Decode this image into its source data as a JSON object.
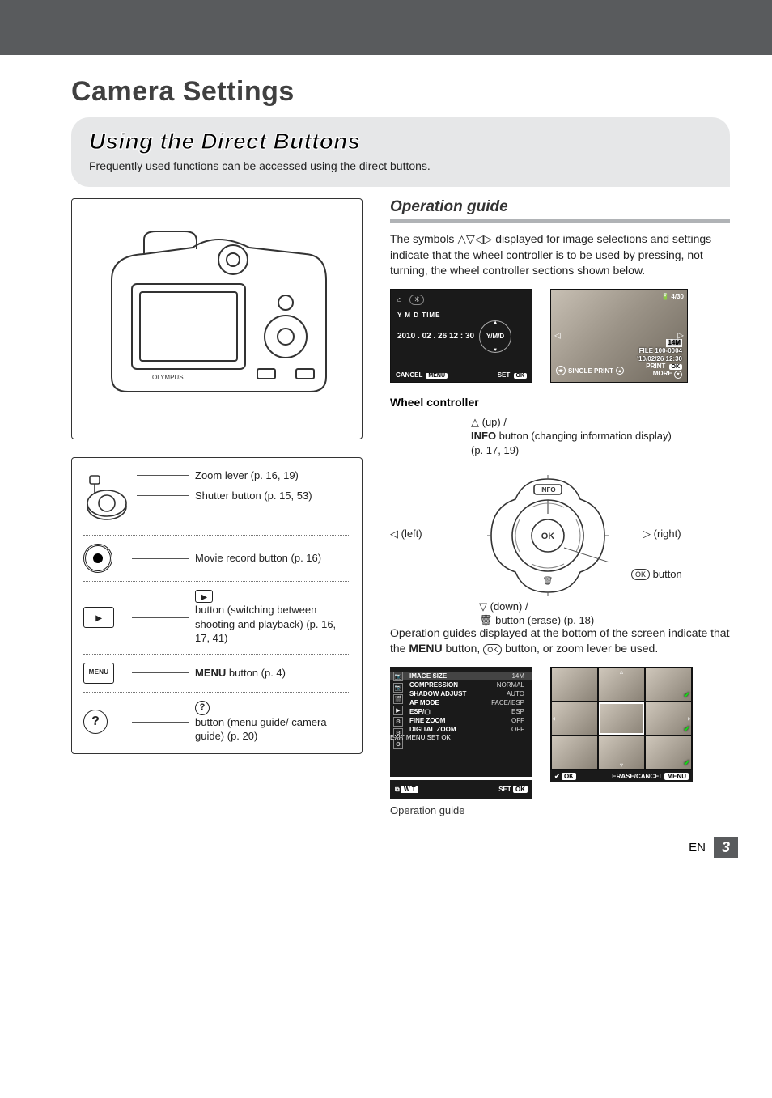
{
  "header": {
    "title": "Camera Settings",
    "section_title": "Using the Direct Buttons",
    "intro": "Frequently used functions can be accessed using the direct buttons."
  },
  "left_panel": {
    "buttons": {
      "zoom_lever": "Zoom lever (p. 16, 19)",
      "shutter": "Shutter button (p. 15, 53)",
      "movie_record": "Movie record button (p. 16)",
      "playback": " button (switching between shooting and playback) (p. 16, 17, 41)",
      "menu_prefix": "MENU",
      "menu_suffix": " button (p. 4)",
      "guide": " button (menu guide/ camera guide) (p. 20)"
    }
  },
  "right_panel": {
    "op_guide_heading": "Operation guide",
    "op_guide_para_a": "The symbols ",
    "op_guide_para_b": " displayed for image selections and settings indicate that the wheel controller is to be used by pressing, not turning, the wheel controller sections shown below.",
    "lcd_date": {
      "ymdt": "Y    M    D     TIME",
      "value": "2010 . 02 . 26   12 : 30",
      "yd": "Y/M/D",
      "cancel": "CANCEL",
      "cancel_tag": "MENU",
      "set": "SET",
      "set_tag": "OK"
    },
    "lcd_photo": {
      "counter": "4/30",
      "size": "14M",
      "file": "100-0004",
      "datetime": "'10/02/26 12:30",
      "single_print": "SINGLE PRINT",
      "print": "PRINT",
      "print_tag": "OK",
      "more": "MORE"
    },
    "wheel_heading": "Wheel controller",
    "wheel": {
      "up_a": " (up) /",
      "up_b": " button (changing information display) (p. 17, 19)",
      "info_bold": "INFO",
      "left": " (left)",
      "right": " (right)",
      "ok_btn": " button",
      "down_a": " (down) /",
      "down_b": " button (erase) (p. 18)",
      "info_tag": "INFO",
      "ok_tag": "OK"
    },
    "op_para2_a": "Operation guides displayed at the bottom of the screen indicate that the ",
    "op_para2_menu": "MENU",
    "op_para2_b": " button, ",
    "op_para2_c": " button, or zoom lever be used.",
    "lcd_menu": {
      "rows": [
        {
          "k": "IMAGE SIZE",
          "v": "14M",
          "hl": true
        },
        {
          "k": "COMPRESSION",
          "v": "NORMAL"
        },
        {
          "k": "SHADOW ADJUST",
          "v": "AUTO"
        },
        {
          "k": "AF MODE",
          "v": "FACE/iESP"
        },
        {
          "k": "ESP/▢",
          "v": "ESP"
        },
        {
          "k": "FINE ZOOM",
          "v": "OFF"
        },
        {
          "k": "DIGITAL ZOOM",
          "v": "OFF"
        }
      ],
      "exit": "EXIT",
      "exit_tag": "MENU",
      "set": "SET",
      "set_tag": "OK"
    },
    "lcd_small": {
      "wt": "W T",
      "set": "SET",
      "set_tag": "OK"
    },
    "thumb": {
      "ok_tag": "OK",
      "erase": "ERASE/CANCEL",
      "erase_tag": "MENU"
    },
    "caption": "Operation guide"
  },
  "footer": {
    "lang": "EN",
    "page": "3"
  }
}
